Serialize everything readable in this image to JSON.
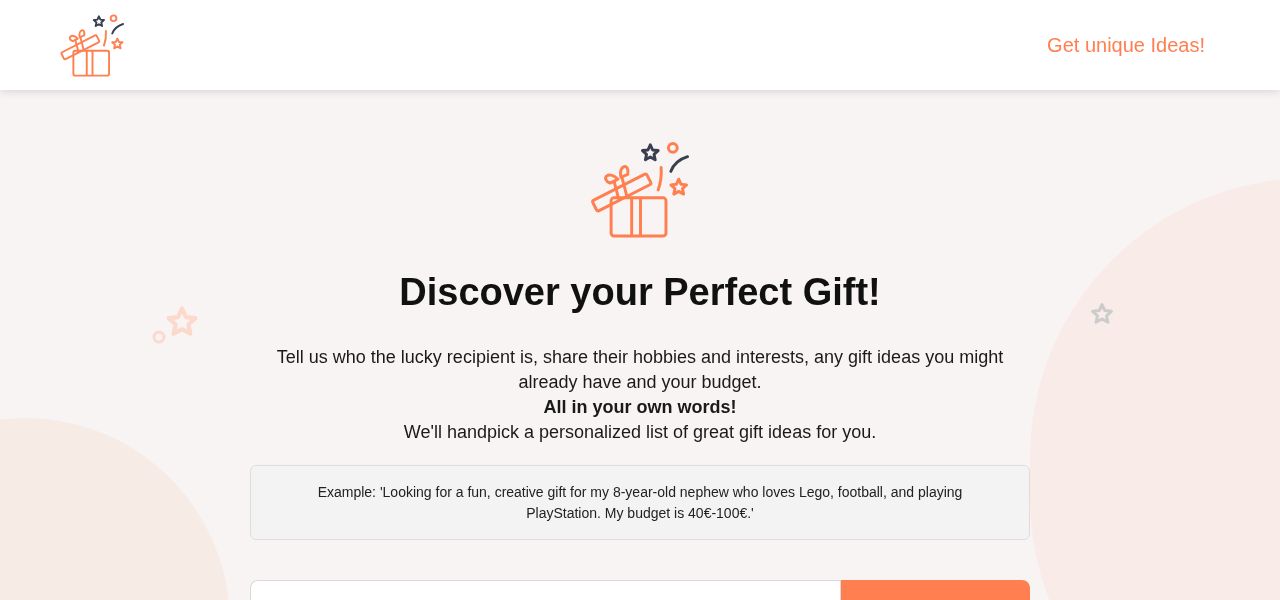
{
  "header": {
    "link": "Get unique Ideas!"
  },
  "hero": {
    "title": "Discover your Perfect Gift!",
    "lines": [
      {
        "kind": "plain",
        "text": "Tell us who the lucky recipient is, share their hobbies and interests, any gift ideas you might already have and your budget."
      },
      {
        "kind": "bold",
        "text": "All in your own words!"
      },
      {
        "kind": "plain",
        "text": "We'll handpick a personalized list of great gift ideas for you."
      }
    ],
    "example": "Example: 'Looking for a fun, creative gift for my 8-year-old nephew who loves Lego, football, and playing PlayStation. My budget is 40€-100€.'"
  }
}
